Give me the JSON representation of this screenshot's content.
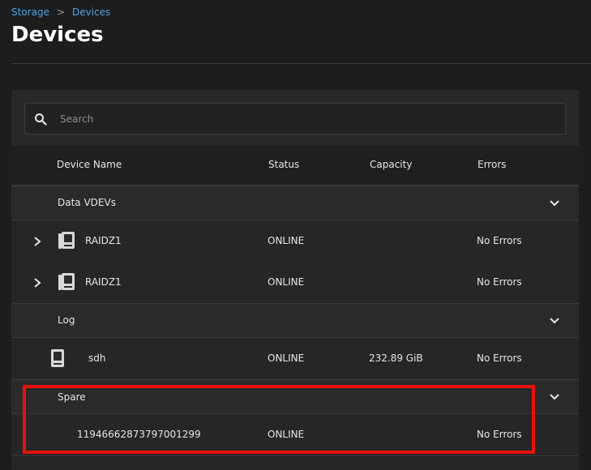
{
  "breadcrumb": {
    "parent": "Storage",
    "separator": ">",
    "current": "Devices"
  },
  "page_title": "Devices",
  "search": {
    "placeholder": "Search"
  },
  "columns": {
    "name": "Device Name",
    "status": "Status",
    "capacity": "Capacity",
    "errors": "Errors"
  },
  "groups": [
    {
      "label": "Data VDEVs"
    },
    {
      "label": "Log"
    },
    {
      "label": "Spare"
    }
  ],
  "devices": [
    {
      "name": "RAIDZ1",
      "status": "ONLINE",
      "capacity": "",
      "errors": "No Errors"
    },
    {
      "name": "RAIDZ1",
      "status": "ONLINE",
      "capacity": "",
      "errors": "No Errors"
    },
    {
      "name": "sdh",
      "status": "ONLINE",
      "capacity": "232.89 GiB",
      "errors": "No Errors"
    },
    {
      "name": "11946662873797001299",
      "status": "ONLINE",
      "capacity": "",
      "errors": "No Errors"
    }
  ],
  "colors": {
    "accent_link": "#4da3e8",
    "highlight_border": "#e81010"
  },
  "icons": [
    "search-icon",
    "chevron-right-icon",
    "chevron-down-icon",
    "disk-icon"
  ]
}
